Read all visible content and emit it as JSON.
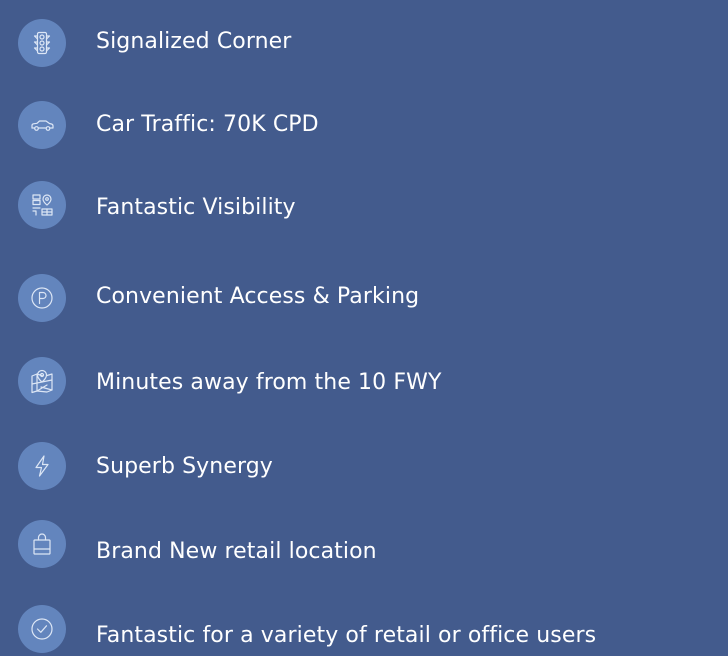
{
  "features": [
    {
      "icon": "traffic-light-icon",
      "label": "Signalized Corner"
    },
    {
      "icon": "car-icon",
      "label": "Car Traffic: 70K CPD"
    },
    {
      "icon": "map-location-icon",
      "label": "Fantastic Visibility"
    },
    {
      "icon": "parking-icon",
      "label": "Convenient Access & Parking"
    },
    {
      "icon": "map-pin-icon",
      "label": "Minutes away from the 10 FWY"
    },
    {
      "icon": "lightning-bolt-icon",
      "label": "Superb Synergy"
    },
    {
      "icon": "shopping-bag-icon",
      "label": "Brand New retail location"
    },
    {
      "icon": "check-circle-icon",
      "label": "Fantastic for a variety of retail or office users"
    }
  ],
  "colors": {
    "background": "#435b8d",
    "icon_circle": "#6385bd",
    "icon_stroke": "#dce6f5",
    "text": "#ffffff"
  }
}
